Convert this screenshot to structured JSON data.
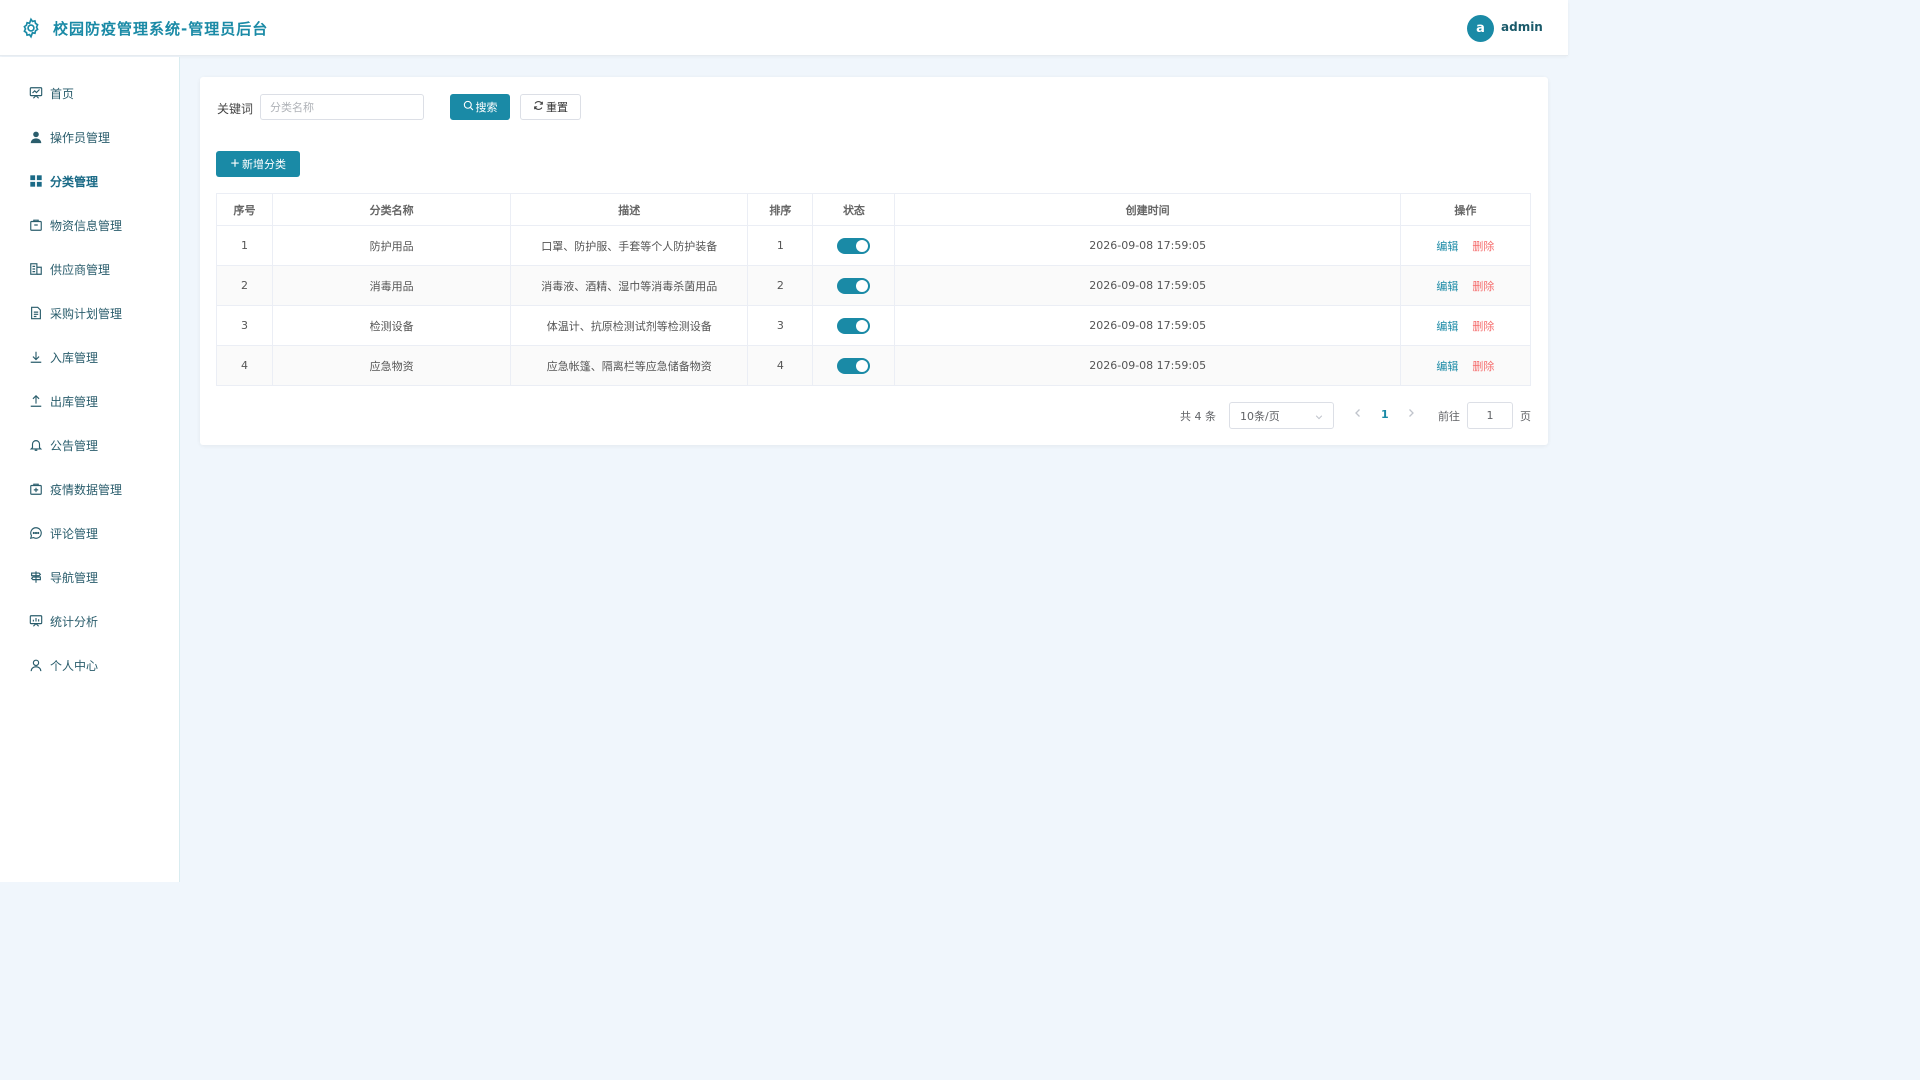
{
  "header": {
    "title": "校园防疫管理系统-管理员后台",
    "avatar_letter": "a",
    "username": "admin"
  },
  "sidebar": {
    "items": [
      {
        "label": "首页",
        "icon": "dashboard-icon"
      },
      {
        "label": "操作员管理",
        "icon": "user-icon"
      },
      {
        "label": "分类管理",
        "icon": "grid-icon",
        "active": true
      },
      {
        "label": "物资信息管理",
        "icon": "box-icon"
      },
      {
        "label": "供应商管理",
        "icon": "building-icon"
      },
      {
        "label": "采购计划管理",
        "icon": "document-icon"
      },
      {
        "label": "入库管理",
        "icon": "download-icon"
      },
      {
        "label": "出库管理",
        "icon": "upload-icon"
      },
      {
        "label": "公告管理",
        "icon": "bell-icon"
      },
      {
        "label": "疫情数据管理",
        "icon": "medical-box-icon"
      },
      {
        "label": "评论管理",
        "icon": "chat-icon"
      },
      {
        "label": "导航管理",
        "icon": "signpost-icon"
      },
      {
        "label": "统计分析",
        "icon": "chart-board-icon"
      },
      {
        "label": "个人中心",
        "icon": "person-icon"
      }
    ]
  },
  "search": {
    "label": "关键词",
    "placeholder": "分类名称",
    "value": "",
    "search_label": "搜索",
    "reset_label": "重置"
  },
  "toolbar": {
    "add_label": "新增分类"
  },
  "table": {
    "headers": [
      "序号",
      "分类名称",
      "描述",
      "排序",
      "状态",
      "创建时间",
      "操作"
    ],
    "rows": [
      {
        "index": "1",
        "name": "防护用品",
        "desc": "口罩、防护服、手套等个人防护装备",
        "sort": "1",
        "enabled": true,
        "created": "2026-09-08 17:59:05"
      },
      {
        "index": "2",
        "name": "消毒用品",
        "desc": "消毒液、酒精、湿巾等消毒杀菌用品",
        "sort": "2",
        "enabled": true,
        "created": "2026-09-08 17:59:05"
      },
      {
        "index": "3",
        "name": "检测设备",
        "desc": "体温计、抗原检测试剂等检测设备",
        "sort": "3",
        "enabled": true,
        "created": "2026-09-08 17:59:05"
      },
      {
        "index": "4",
        "name": "应急物资",
        "desc": "应急帐篷、隔离栏等应急储备物资",
        "sort": "4",
        "enabled": true,
        "created": "2026-09-08 17:59:05"
      }
    ],
    "edit_label": "编辑",
    "delete_label": "删除"
  },
  "pagination": {
    "total_text": "共 4 条",
    "page_size": "10条/页",
    "current_page": "1",
    "goto_label": "前往",
    "goto_value": "1",
    "goto_suffix": "页"
  },
  "colors": {
    "accent": "#1a8aa6",
    "danger": "#f56c6c",
    "background": "#f0f6fc"
  }
}
